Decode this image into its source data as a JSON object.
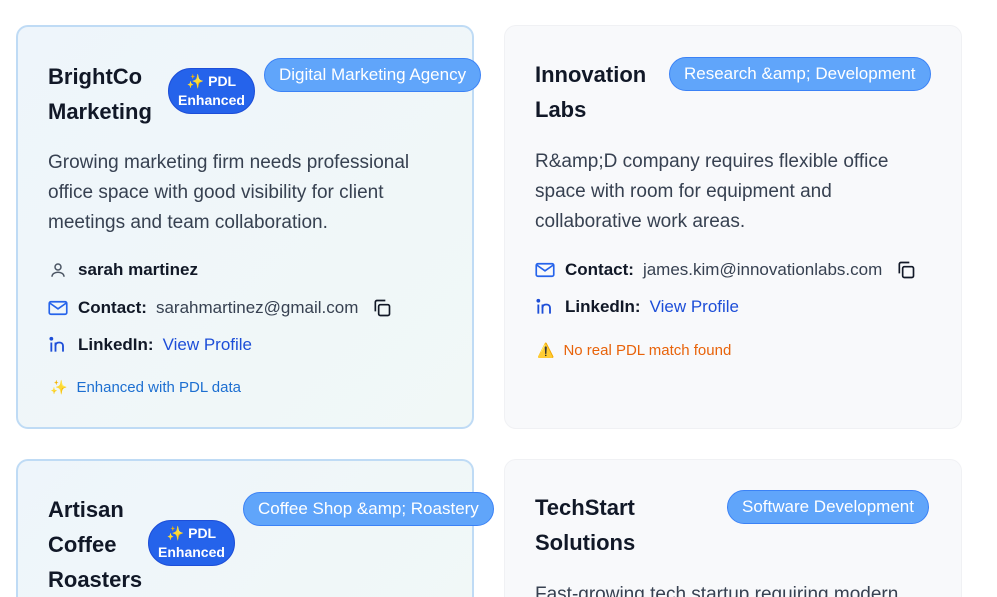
{
  "cards": [
    {
      "title_line1": "BrightCo",
      "title_line2": "Marketing",
      "badge_line1": "✨ PDL",
      "badge_line2": "Enhanced",
      "category": "Digital Marketing Agency",
      "description": "Growing marketing firm needs professional office space with good visibility for client meetings and team collaboration.",
      "person": "sarah martinez",
      "contact_label": "Contact:",
      "contact_email": "sarahmartinez@gmail.com",
      "linkedin_label": "LinkedIn:",
      "linkedin_link": "View Profile",
      "note": "Enhanced with PDL data",
      "note_icon": "✨"
    },
    {
      "title_line1": "Innovation",
      "title_line2": "Labs",
      "category": "Research &amp; Development",
      "description": "R&amp;D company requires flexible office space with room for equipment and collaborative work areas.",
      "contact_label": "Contact:",
      "contact_email": "james.kim@innovationlabs.com",
      "linkedin_label": "LinkedIn:",
      "linkedin_link": "View Profile",
      "note": "No real PDL match found",
      "note_icon": "⚠️"
    },
    {
      "title_line1": "Artisan",
      "title_line2": "Coffee",
      "title_line3": "Roasters",
      "badge_line1": "✨ PDL",
      "badge_line2": "Enhanced",
      "category": "Coffee Shop &amp; Roastery"
    },
    {
      "title_line1": "TechStart",
      "title_line2": "Solutions",
      "category": "Software Development",
      "description": "Fast-growing tech startup requiring modern"
    }
  ],
  "colors": {
    "accent": "#2563eb",
    "pill": "#60a5fa",
    "link": "#1d4ed8",
    "warning": "#e8630a",
    "enhanced_border": "#bfdbf5"
  },
  "icons": [
    "user-icon",
    "mail-icon",
    "linkedin-icon",
    "copy-icon",
    "sparkles-icon",
    "warning-icon"
  ]
}
